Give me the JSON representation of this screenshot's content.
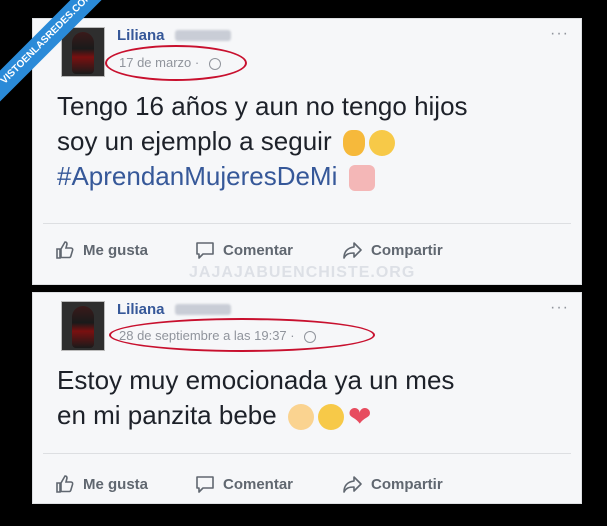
{
  "watermark": {
    "ribbon": "VISTOENLASREDES.COM",
    "footer": "JAJAJABUENCHISTE.ORG"
  },
  "post1": {
    "author": "Liliana",
    "date": "17 de marzo · ",
    "text_line1": "Tengo 16 años y aun no tengo hijos",
    "text_line2": "soy un ejemplo a seguir",
    "hashtag": "#AprendanMujeresDeMi",
    "more": "···",
    "like": "Me gusta",
    "comment": "Comentar",
    "share": "Compartir"
  },
  "post2": {
    "author": "Liliana",
    "date": "28 de septiembre a las 19:37 · ",
    "text_line1": "Estoy muy emocionada ya un mes",
    "text_line2": "en mi panzita bebe",
    "more": "···",
    "like": "Me gusta",
    "comment": "Comentar",
    "share": "Compartir"
  },
  "icons": [
    "thumbs-up-icon",
    "comment-icon",
    "share-icon",
    "globe-icon"
  ],
  "colors": {
    "link": "#365899",
    "highlight_circle": "#c8102e",
    "action": "#606770"
  }
}
